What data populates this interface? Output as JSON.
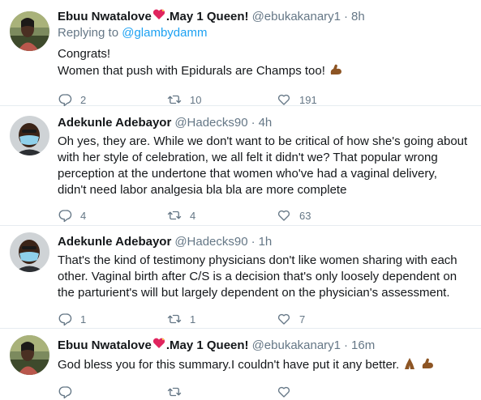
{
  "tweets": [
    {
      "name": "Ebuu Nwatalove",
      "name_suffix": ".May 1 Queen!",
      "handle": "@ebukakanary1",
      "time": "8h",
      "reply_prefix": "Replying to",
      "reply_to": "@glambydamm",
      "lines": [
        "Congrats!",
        "Women that push with Epidurals are Champs too!"
      ],
      "replies": "2",
      "retweets": "10",
      "likes": "191"
    },
    {
      "name": "Adekunle Adebayor",
      "handle": "@Hadecks90",
      "time": "4h",
      "lines": [
        "Oh yes, they are. While we don't want to be critical of how she's going about",
        "with her style of celebration, we all felt it didn't we? That popular wrong",
        "perception at the undertone that women who've had a vaginal delivery,",
        "didn't need labor analgesia bla bla are more complete"
      ],
      "replies": "4",
      "retweets": "4",
      "likes": "63"
    },
    {
      "name": "Adekunle Adebayor",
      "handle": "@Hadecks90",
      "time": "1h",
      "lines": [
        "That's the kind of testimony physicians don't like women sharing with each",
        "other. Vaginal birth after C/S is a decision that's only loosely dependent on",
        "the parturient's will but largely dependent on the physician's assessment."
      ],
      "replies": "1",
      "retweets": "1",
      "likes": "7"
    },
    {
      "name": "Ebuu Nwatalove",
      "name_suffix": ".May 1 Queen!",
      "handle": "@ebukakanary1",
      "time": "16m",
      "lines": [
        "God bless you for this summary.I couldn't have put it any better."
      ],
      "replies": "",
      "retweets": "",
      "likes": ""
    }
  ],
  "colors": {
    "text": "#14171a",
    "secondary": "#657786",
    "link": "#1da1f2",
    "heart": "#e0245e",
    "divider": "#e6ecf0"
  },
  "icons": [
    "reply-icon",
    "retweet-icon",
    "like-icon",
    "sparkle-heart-icon",
    "flexed-biceps-icon",
    "folded-hands-icon"
  ]
}
